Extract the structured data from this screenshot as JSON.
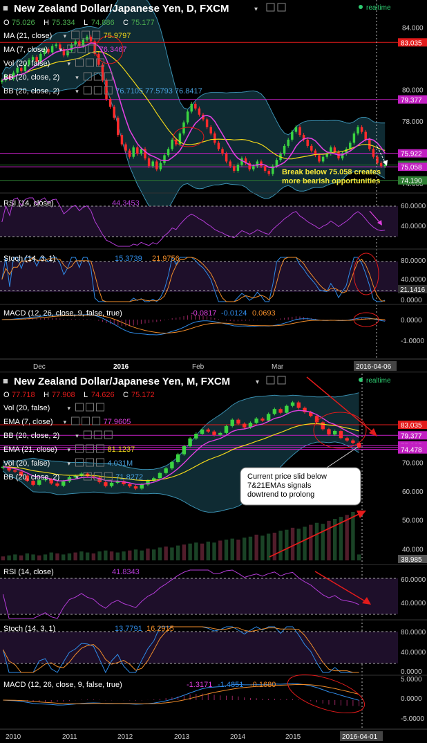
{
  "daily": {
    "title": "New Zealand Dollar/Japanese Yen, D, FXCM",
    "realtime": "realtime",
    "ohlc": {
      "o_label": "O",
      "o": "75.026",
      "h_label": "H",
      "h": "75.334",
      "l_label": "L",
      "l": "74.886",
      "c_label": "C",
      "c": "75.177"
    },
    "indicators": [
      {
        "label": "MA (21, close)",
        "value": "75.9797",
        "color": "#f1d71a"
      },
      {
        "label": "MA (7, close)",
        "value": "76.3467",
        "color": "#e040e0"
      },
      {
        "label": "Vol (20, false)",
        "value": "",
        "color": "#cccccc"
      },
      {
        "label": "BB (20, close, 2)",
        "value": "",
        "color": "#cccccc"
      },
      {
        "label": "BB (20, close, 2)",
        "value": "76.7105  77.5793  76.8417",
        "color": "#4aa3df"
      }
    ],
    "price_axis": [
      "84.000",
      "80.000",
      "78.000",
      "76.000",
      "74.000"
    ],
    "price_tags": [
      {
        "v": 83.035,
        "label": "83.035",
        "bg": "#e31b1b"
      },
      {
        "v": 79.377,
        "label": "79.377",
        "bg": "#c21fc2"
      },
      {
        "v": 75.922,
        "label": "75.922",
        "bg": "#c21fc2"
      },
      {
        "v": 75.177,
        "label": "75.177",
        "bg": "#2e7d32"
      },
      {
        "v": 75.058,
        "label": "75.058",
        "bg": "#c21fc2"
      },
      {
        "v": 74.19,
        "label": "74.190",
        "bg": "#2e7d32"
      }
    ],
    "annotation": [
      "Break below 75.058 creates",
      "more bearish opportunities"
    ],
    "rsi": {
      "label": "RSI (14, close)",
      "value": "44.3453",
      "axis": [
        "60.0000",
        "40.0000"
      ]
    },
    "stoch": {
      "label": "Stoch (14, 3, 1)",
      "k": "15.3739",
      "d": "21.9756",
      "axis": [
        "80.0000",
        "40.0000",
        "0.0000"
      ],
      "tag": "21.1416"
    },
    "macd": {
      "label": "MACD (12, 26, close, 9, false, true)",
      "v1": "-0.0817",
      "v2": "-0.0124",
      "v3": "0.0693",
      "axis": [
        "0.0000",
        "-1.0000"
      ]
    },
    "x_labels": [
      "Dec",
      "2016",
      "Feb",
      "Mar"
    ],
    "date_tag": "2016-04-06"
  },
  "monthly": {
    "title": "New Zealand Dollar/Japanese Yen, M, FXCM",
    "realtime": "realtime",
    "ohlc": {
      "o_label": "O",
      "o": "77.718",
      "h_label": "H",
      "h": "77.908",
      "l_label": "L",
      "l": "74.626",
      "c_label": "C",
      "c": "75.172"
    },
    "indicators": [
      {
        "label": "Vol (20, false)",
        "value": "",
        "color": "#cccccc"
      },
      {
        "label": "EMA (7, close)",
        "value": "77.9605",
        "color": "#e040e0"
      },
      {
        "label": "BB (20, close, 2)",
        "value": "",
        "color": "#cccccc"
      },
      {
        "label": "EMA (21, close)",
        "value": "81.1237",
        "color": "#f1d71a"
      },
      {
        "label": "Vol (20, false)",
        "value": "4.031M",
        "color": "#4aa3df"
      },
      {
        "label": "BB (20, close, 2)",
        "value": "71.8272",
        "color": "#4aa3df"
      }
    ],
    "price_axis": [
      "70.000",
      "60.000",
      "50.000",
      "40.000"
    ],
    "price_tags": [
      {
        "v": 83.035,
        "label": "83.035",
        "bg": "#e31b1b"
      },
      {
        "v": 79.377,
        "label": "79.377",
        "bg": "#c21fc2"
      },
      {
        "v": 75.925,
        "label": "75.925",
        "bg": "#c21fc2"
      },
      {
        "v": 75.172,
        "label": "75.172",
        "bg": "#c21fc2"
      },
      {
        "v": 74.478,
        "label": "74.478",
        "bg": "#c21fc2"
      }
    ],
    "vol_tag": "38.985",
    "annotation": [
      "Current price slid below",
      "7&21EMAs signals",
      "dowtrend to prolong"
    ],
    "rsi": {
      "label": "RSI (14, close)",
      "value": "41.8343",
      "axis": [
        "60.0000",
        "40.0000"
      ]
    },
    "stoch": {
      "label": "Stoch (14, 3, 1)",
      "k": "13.7791",
      "d": "16.2915",
      "axis": [
        "80.0000",
        "40.0000",
        "0.0000"
      ]
    },
    "macd": {
      "label": "MACD (12, 26, close, 9, false, true)",
      "v1": "-1.3171",
      "v2": "-1.4851",
      "v3": "-0.1680",
      "axis": [
        "5.0000",
        "0.0000",
        "-5.0000"
      ]
    },
    "x_labels": [
      "2010",
      "2011",
      "2012",
      "2013",
      "2014",
      "2015"
    ],
    "date_tag": "2016-04-01"
  },
  "chart_data": [
    {
      "type": "candlestick",
      "title": "New Zealand Dollar/Japanese Yen, D, FXCM",
      "ylim": [
        73.6,
        84.6
      ],
      "series": [
        {
          "name": "NZDJPY",
          "close": [
            80.6,
            80.9,
            80.7,
            81.1,
            81.4,
            81.2,
            81.6,
            81.9,
            82.1,
            81.8,
            82.3,
            82.6,
            82.4,
            82.8,
            82.9,
            82.6,
            82.2,
            82.5,
            82.9,
            83.1,
            82.8,
            83.2,
            83.4,
            83.1,
            82.3,
            81.6,
            80.6,
            79.4,
            78.9,
            78.2,
            77.1,
            76.5,
            76.1,
            75.7,
            76.3,
            75.9,
            76.2,
            75.6,
            75.1,
            75.4,
            74.9,
            75.3,
            75.8,
            76.2,
            76.8,
            76.5,
            77.2,
            77.9,
            78.6,
            79.1,
            78.8,
            78.4,
            78.1,
            77.6,
            77.2,
            76.6,
            76.2,
            75.9,
            75.4,
            75.1,
            74.8,
            75.2,
            75.6,
            75.3,
            74.9,
            75.1,
            75.4,
            75.1,
            74.8,
            74.6,
            75.1,
            75.5,
            75.9,
            76.4,
            76.8,
            77.3,
            77.6,
            77.1,
            76.8,
            76.4,
            76.1,
            75.8,
            75.4,
            75.7,
            75.9,
            76.3,
            76.0,
            75.6,
            75.9,
            76.2,
            76.6,
            77.2,
            77.6,
            77.3,
            76.8,
            76.2,
            75.7,
            75.3,
            75.1,
            75.177
          ]
        }
      ]
    },
    {
      "type": "candlestick",
      "title": "New Zealand Dollar/Japanese Yen, M, FXCM",
      "ylim": [
        36.0,
        96.0
      ],
      "series": [
        {
          "name": "NZDJPY",
          "close": [
            68.5,
            67.2,
            66.8,
            65.4,
            63.6,
            62.2,
            63.8,
            64.1,
            62.7,
            61.9,
            63.4,
            64.8,
            65.3,
            66.1,
            65.2,
            64.7,
            63.1,
            61.8,
            62.9,
            63.5,
            62.4,
            61.7,
            60.9,
            62.3,
            63.6,
            64.5,
            66.3,
            67.9,
            70.1,
            72.8,
            75.6,
            78.3,
            79.9,
            81.4,
            80.7,
            79.5,
            80.2,
            82.6,
            84.8,
            83.4,
            82.1,
            83.7,
            85.2,
            84.5,
            86.8,
            88.5,
            87.2,
            89.6,
            90.8,
            88.9,
            87.4,
            86.1,
            83.9,
            81.5,
            79.7,
            80.9,
            78.4,
            77.6,
            76.8,
            75.172
          ]
        }
      ],
      "volume": [
        4,
        5,
        6,
        5,
        7,
        6,
        5,
        6,
        8,
        7,
        6,
        7,
        8,
        9,
        8,
        7,
        9,
        10,
        9,
        8,
        9,
        10,
        11,
        10,
        12,
        11,
        13,
        14,
        13,
        15,
        16,
        17,
        18,
        17,
        19,
        18,
        20,
        21,
        22,
        21,
        23,
        24,
        26,
        25,
        27,
        28,
        30,
        31,
        33,
        32,
        34,
        36,
        38,
        37,
        40,
        42,
        44,
        46,
        49,
        6
      ]
    }
  ]
}
